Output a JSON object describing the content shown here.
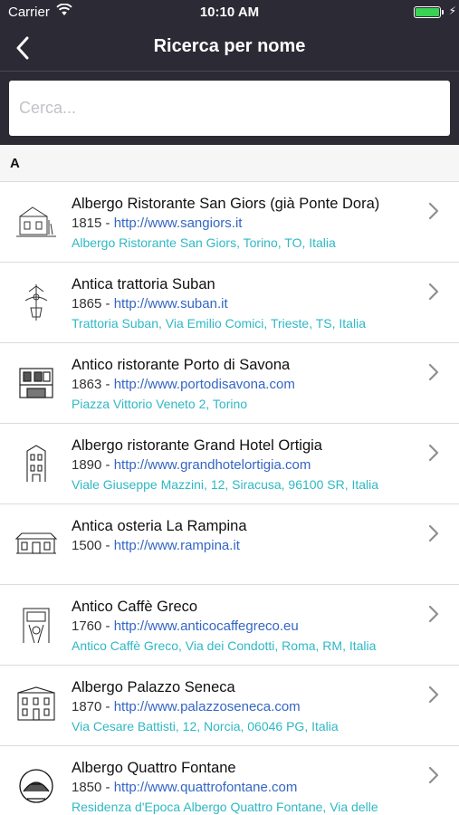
{
  "status_bar": {
    "carrier": "Carrier",
    "time": "10:10 AM",
    "battery_level": 1.0,
    "battery_color": "#39d353"
  },
  "nav": {
    "back_icon": "chevron-left-icon",
    "title": "Ricerca per nome"
  },
  "search": {
    "placeholder": "Cerca...",
    "value": ""
  },
  "section_header": "A",
  "items": [
    {
      "name": "Albergo Ristorante San Giors (già Ponte Dora)",
      "year": "1815",
      "url": "http://www.sangiors.it",
      "address": "Albergo Ristorante San Giors, Torino, TO, Italia"
    },
    {
      "name": "Antica trattoria Suban",
      "year": "1865",
      "url": "http://www.suban.it",
      "address": "Trattoria Suban, Via Emilio Comici, Trieste, TS, Italia"
    },
    {
      "name": "Antico ristorante Porto di Savona",
      "year": "1863",
      "url": "http://www.portodisavona.com",
      "address": "Piazza Vittorio Veneto 2, Torino"
    },
    {
      "name": "Albergo ristorante Grand Hotel Ortigia",
      "year": "1890",
      "url": "http://www.grandhotelortigia.com",
      "address": "Viale Giuseppe Mazzini, 12, Siracusa, 96100 SR, Italia"
    },
    {
      "name": "Antica osteria La Rampina",
      "year": "1500",
      "url": "http://www.rampina.it",
      "address": ""
    },
    {
      "name": "Antico Caffè Greco",
      "year": "1760",
      "url": "http://www.anticocaffegreco.eu",
      "address": "Antico Caffè Greco, Via dei Condotti, Roma, RM, Italia"
    },
    {
      "name": "Albergo Palazzo Seneca",
      "year": "1870",
      "url": "http://www.palazzoseneca.com",
      "address": "Via Cesare Battisti, 12, Norcia, 06046 PG, Italia"
    },
    {
      "name": "Albergo Quattro Fontane",
      "year": "1850",
      "url": "http://www.quattrofontane.com",
      "address": "Residenza d'Epoca Albergo Quattro Fontane, Via delle"
    }
  ],
  "colors": {
    "header_bg": "#2b2a35",
    "link": "#3466c4",
    "address": "#2fb8c4"
  }
}
